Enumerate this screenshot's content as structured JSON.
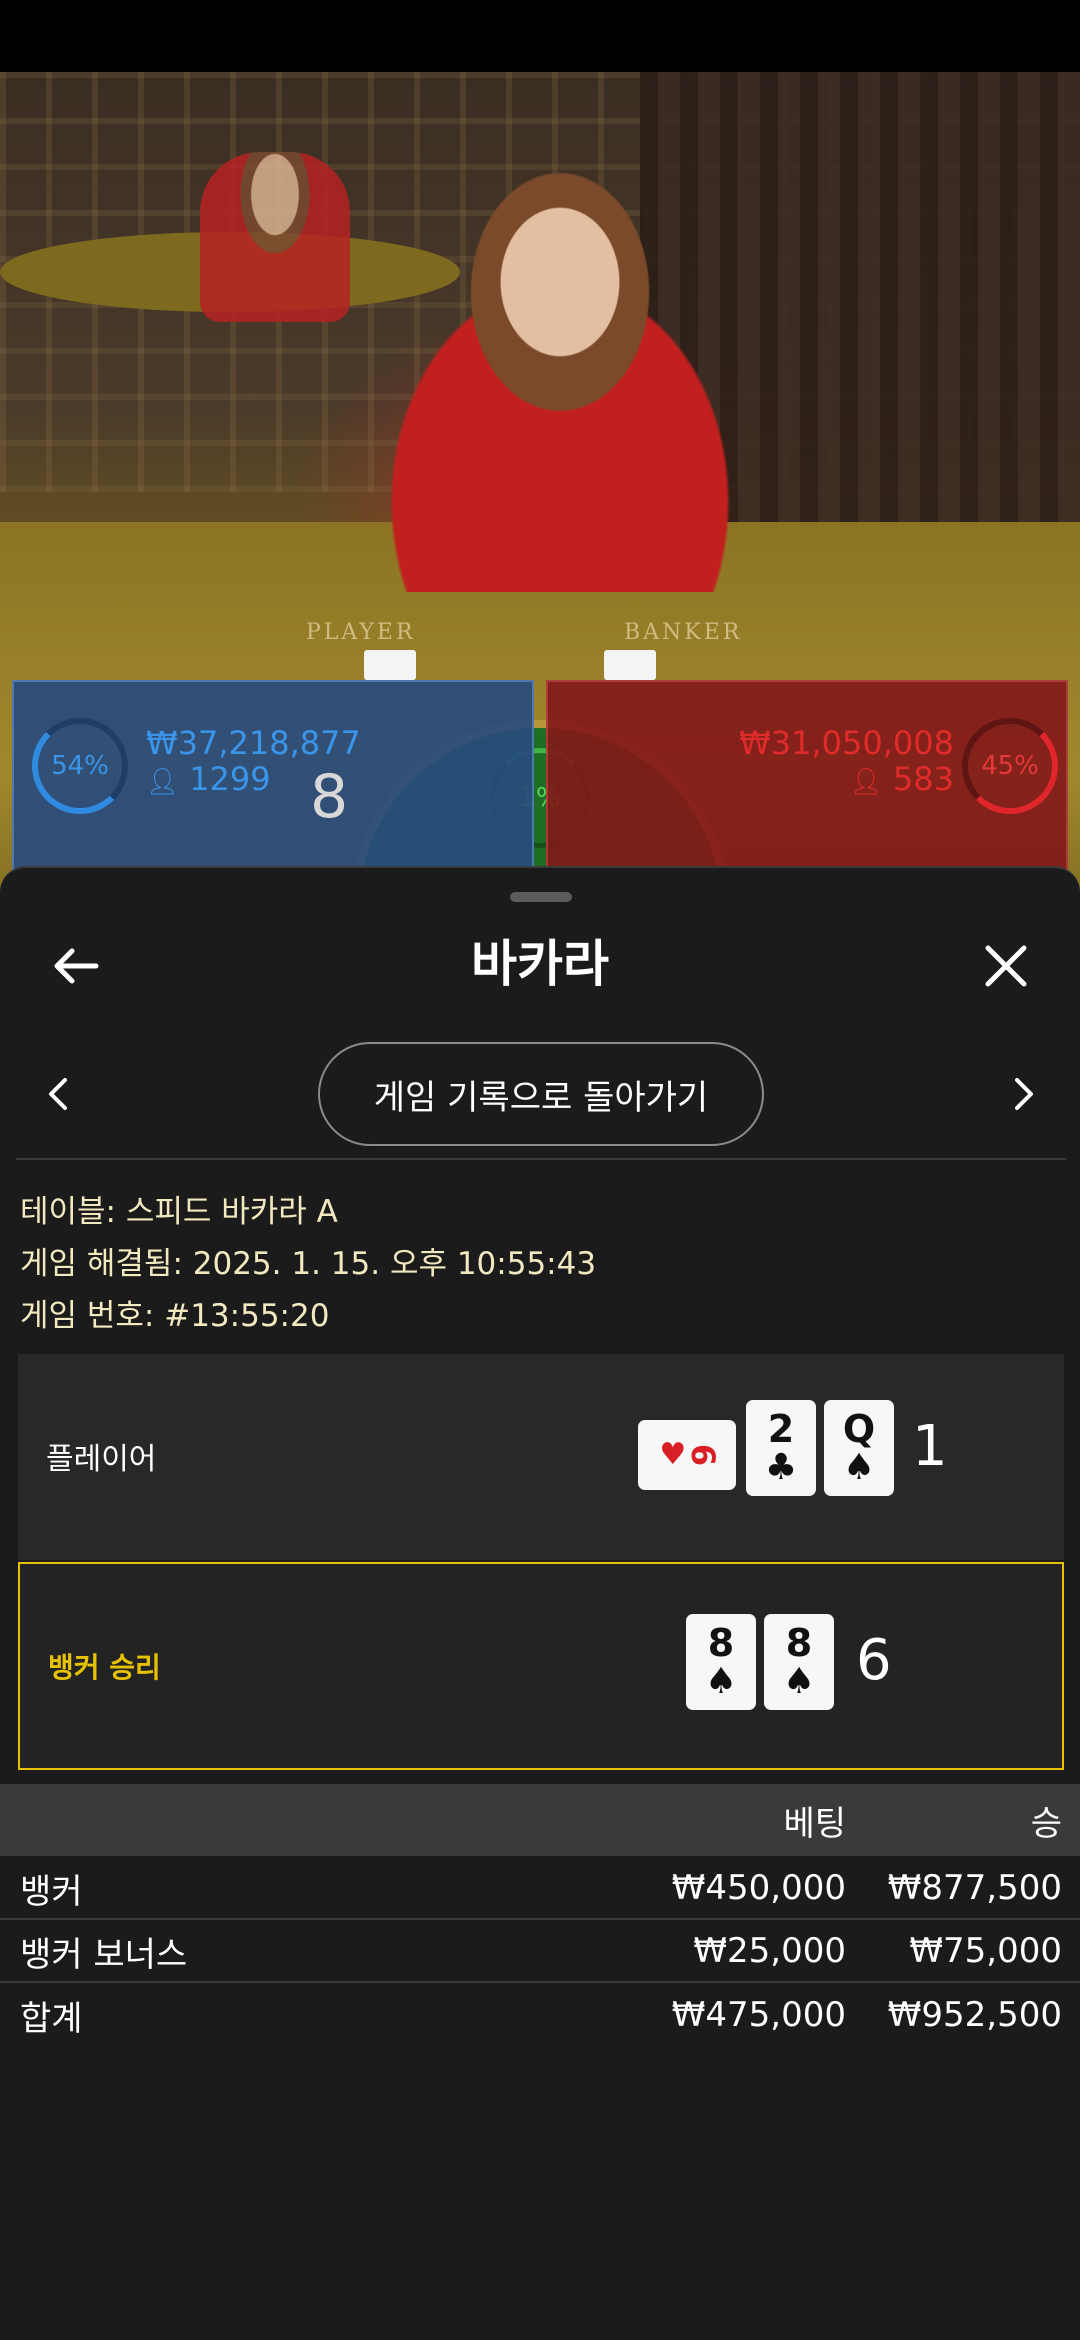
{
  "video": {
    "table_labels": [
      "PLAYER",
      "BANKER"
    ]
  },
  "bets": {
    "player": {
      "percent": "54%",
      "amount": "₩37,218,877",
      "players": "1299",
      "score": "8"
    },
    "tie": {
      "percent": "1%"
    },
    "banker": {
      "percent": "45%",
      "amount": "₩31,050,008",
      "players": "583"
    }
  },
  "sheet": {
    "title": "바카라",
    "back_icon": "arrow-left-icon",
    "close_icon": "close-icon",
    "nav": {
      "label": "게임 기록으로 돌아가기",
      "prev_icon": "chevron-left-icon",
      "next_icon": "chevron-right-icon"
    },
    "info": {
      "table": "테이블: 스피드 바카라 A",
      "resolved": "게임 해결됨: 2025. 1. 15. 오후 10:55:43",
      "number": "게임 번호: #13:55:20"
    },
    "hands": {
      "player": {
        "label": "플레이어",
        "cards": [
          {
            "rank": "6",
            "suit": "♥",
            "color": "#d81f26",
            "orientation": "sideways"
          },
          {
            "rank": "2",
            "suit": "♣",
            "color": "#111111"
          },
          {
            "rank": "Q",
            "suit": "♠",
            "color": "#111111"
          }
        ],
        "score": "1"
      },
      "banker": {
        "label": "뱅커 승리",
        "label_color": "#e6c200",
        "cards": [
          {
            "rank": "8",
            "suit": "♠",
            "color": "#111111"
          },
          {
            "rank": "8",
            "suit": "♠",
            "color": "#111111"
          }
        ],
        "score": "6"
      }
    },
    "table": {
      "headers": {
        "name": "",
        "bet": "베팅",
        "win": "승"
      },
      "rows": [
        {
          "name": "뱅커",
          "bet": "₩450,000",
          "win": "₩877,500"
        },
        {
          "name": "뱅커 보너스",
          "bet": "₩25,000",
          "win": "₩75,000"
        },
        {
          "name": "합계",
          "bet": "₩475,000",
          "win": "₩952,500"
        }
      ]
    }
  }
}
